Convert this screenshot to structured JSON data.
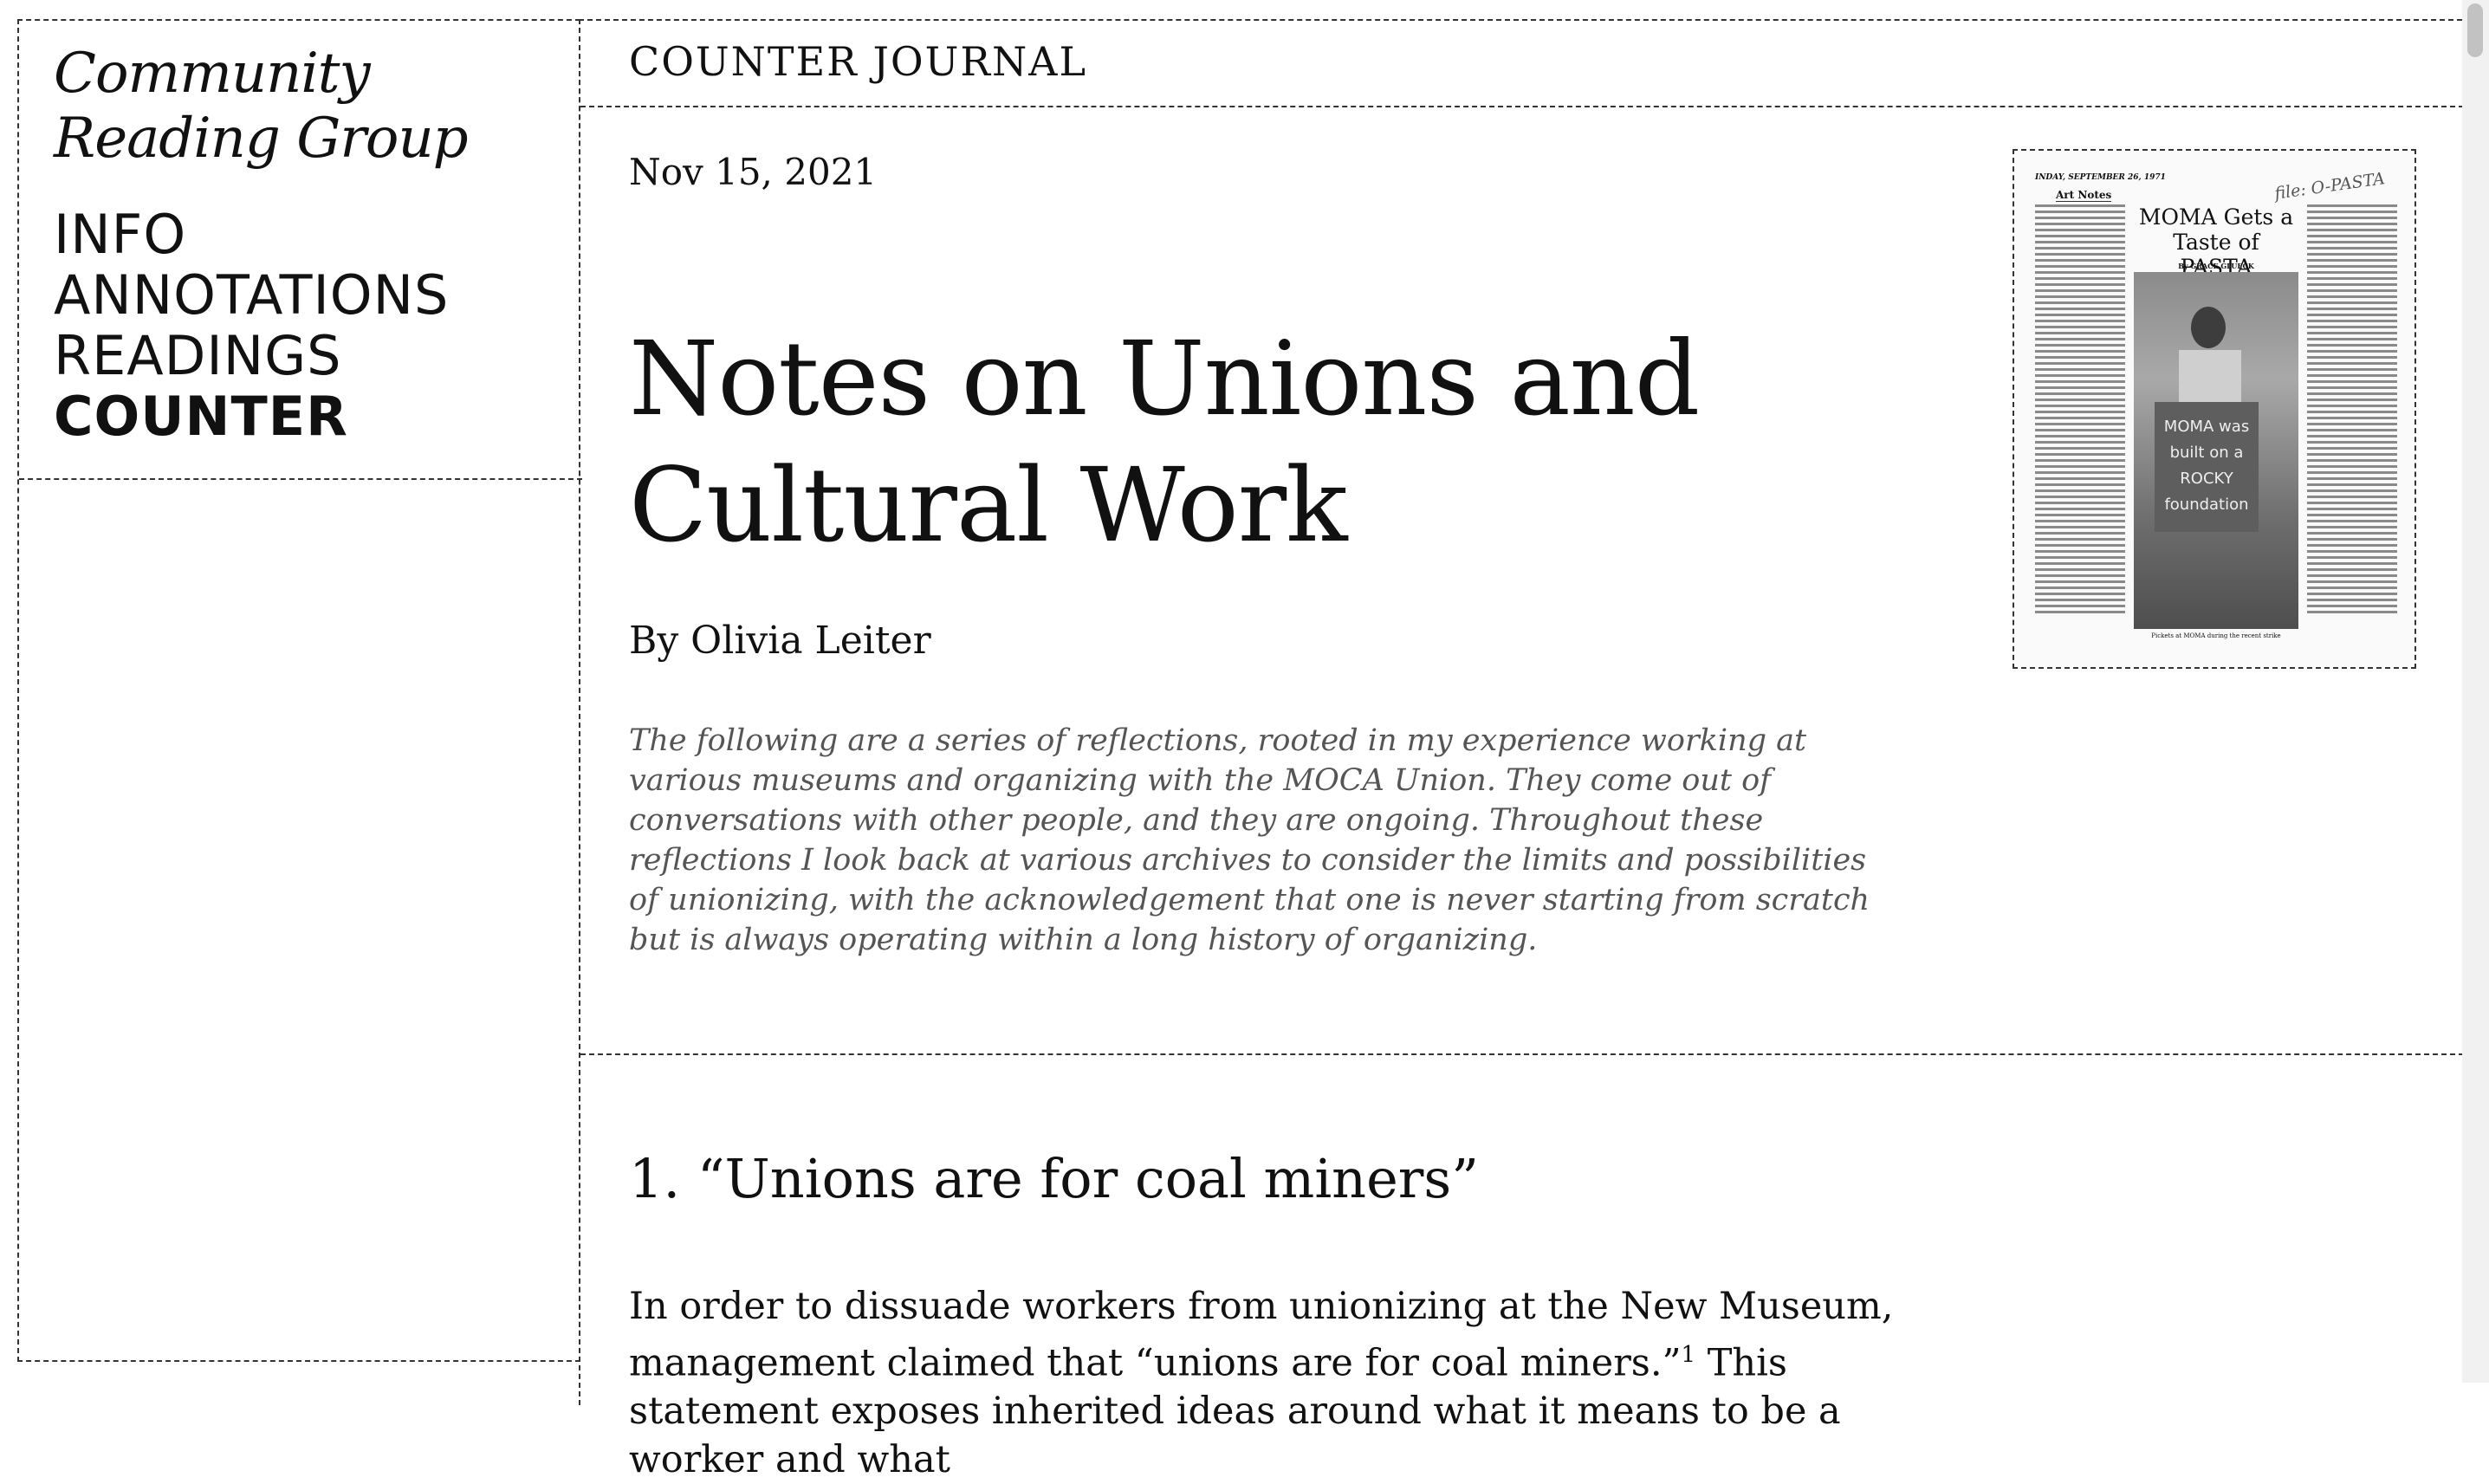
{
  "sidebar": {
    "site_title_line1": "Community",
    "site_title_line2": "Reading Group",
    "nav": [
      {
        "label": "INFO"
      },
      {
        "label": "ANNOTATIONS"
      },
      {
        "label": "READINGS"
      },
      {
        "label": "COUNTER",
        "active": true
      }
    ]
  },
  "journal": {
    "name": "COUNTER JOURNAL"
  },
  "article": {
    "date": "Nov 15, 2021",
    "title": "Notes on Unions and Cultural Work",
    "byline": "By Olivia Leiter",
    "abstract": "The following are a series of reflections, rooted in my experience working at various museums and organizing with the MOCA Union. They come out of conversations with other people, and they are ongoing. Throughout these reflections I look back at various archives to consider the limits and possibilities of unionizing, with the acknowledgement that one is never starting from scratch but is always operating within a long history of organizing.",
    "clipping": {
      "date": "INDAY, SEPTEMBER 26, 1971",
      "section": "Art Notes",
      "headline": "MOMA Gets a Taste of PASTA",
      "byline": "By GRACE GLUECK",
      "note": "file: O-PASTA",
      "sign_text": "MOMA was built on a ROCKY foundation",
      "caption": "Pickets at MOMA during the recent strike"
    },
    "section_heading": "1. “Unions are for coal miners”",
    "body_lead": "In order to dissuade workers from unionizing at the New Museum, management claimed that “unions are for coal miners.”",
    "footnote_mark": "1",
    "body_tail": " This statement exposes inherited ideas around what it means to be a worker and what"
  },
  "colors": {
    "text": "#111111",
    "abstract": "#555555",
    "rule": "#333333"
  }
}
